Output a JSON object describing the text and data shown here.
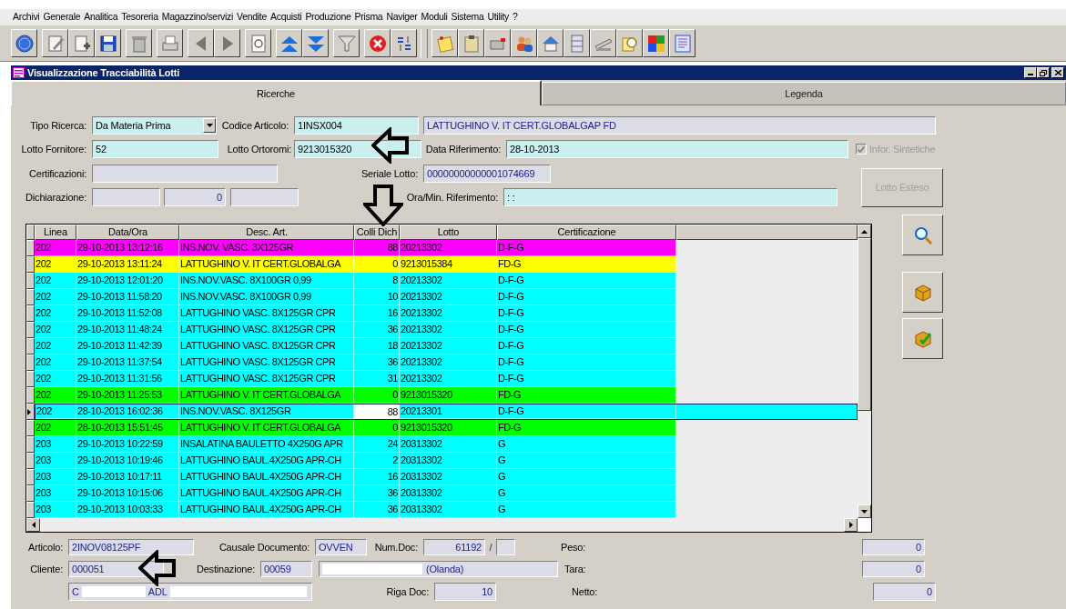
{
  "menu": [
    "Archivi",
    "Generale",
    "Analitica",
    "Tesoreria",
    "Magazzino/servizi",
    "Vendite",
    "Acquisti",
    "Produzione",
    "Prisma",
    "Naviger",
    "Moduli",
    "Sistema",
    "Utility",
    "?"
  ],
  "window": {
    "title": "Visualizzazione Tracciabilità Lotti"
  },
  "tabs": [
    {
      "label": "Ricerche",
      "selected": true
    },
    {
      "label": "Legenda",
      "selected": false
    }
  ],
  "search_form": {
    "tipo_ricerca": {
      "label": "Tipo Ricerca:",
      "value": "Da Materia Prima"
    },
    "codice_articolo": {
      "label": "Codice Articolo:",
      "value": "1INSX004",
      "description": "LATTUGHINO V. IT CERT.GLOBALGAP FD"
    },
    "lotto_fornitore": {
      "label": "Lotto Fornitore:",
      "value": "52"
    },
    "lotto_ortoromi": {
      "label": "Lotto Ortoromi:",
      "value": "9213015320"
    },
    "data_riferimento": {
      "label": "Data Riferimento:",
      "value": "28-10-2013"
    },
    "infor_sintetiche": {
      "label": "Infor. Sintetiche",
      "checked": true,
      "disabled": true
    },
    "certificazioni": {
      "label": "Certificazioni:"
    },
    "seriale_lotto": {
      "label": "Seriale Lotto:",
      "value": "00000000000001074669"
    },
    "dichiarazione": {
      "label": "Dichiarazione:",
      "number": "0"
    },
    "ora_min_riferimento": {
      "label": "Ora/Min. Riferimento:",
      "value": ": :"
    },
    "lotto_esteso_button": {
      "label": "Lotto Esteso",
      "disabled": true
    }
  },
  "table": {
    "columns": [
      "Linea",
      "Data/Ora",
      "Desc. Art.",
      "Colli Dich",
      "Lotto",
      "Certificazione"
    ],
    "rows": [
      {
        "cells": [
          "202",
          "29-10-2013 13:12:16",
          "INS.NOV. VASC. 3X125GR",
          "88",
          "20213302",
          "D-F-G"
        ],
        "color": "#ff00ff",
        "selected": false
      },
      {
        "cells": [
          "202",
          "29-10-2013 13:11:24",
          "LATTUGHINO V. IT CERT.GLOBALGA",
          "0",
          "9213015384",
          "FD-G"
        ],
        "color": "#ffff00",
        "selected": false
      },
      {
        "cells": [
          "202",
          "29-10-2013 12:01:20",
          "INS.NOV.VASC. 8X100GR  0,99",
          "8",
          "20213302",
          "D-F-G"
        ],
        "color": "#00ffff",
        "selected": false
      },
      {
        "cells": [
          "202",
          "29-10-2013 11:58:20",
          "INS.NOV.VASC. 8X100GR  0,99",
          "10",
          "20213302",
          "D-F-G"
        ],
        "color": "#00ffff",
        "selected": false
      },
      {
        "cells": [
          "202",
          "29-10-2013 11:52:08",
          "LATTUGHINO VASC. 8X125GR CPR",
          "16",
          "20213302",
          "D-F-G"
        ],
        "color": "#00ffff",
        "selected": false
      },
      {
        "cells": [
          "202",
          "29-10-2013 11:48:24",
          "LATTUGHINO VASC. 8X125GR CPR",
          "36",
          "20213302",
          "D-F-G"
        ],
        "color": "#00ffff",
        "selected": false
      },
      {
        "cells": [
          "202",
          "29-10-2013 11:42:39",
          "LATTUGHINO VASC. 8X125GR CPR",
          "18",
          "20213302",
          "D-F-G"
        ],
        "color": "#00ffff",
        "selected": false
      },
      {
        "cells": [
          "202",
          "29-10-2013 11:37:54",
          "LATTUGHINO VASC. 8X125GR CPR",
          "36",
          "20213302",
          "D-F-G"
        ],
        "color": "#00ffff",
        "selected": false
      },
      {
        "cells": [
          "202",
          "29-10-2013 11:31:56",
          "LATTUGHINO VASC. 8X125GR CPR",
          "31",
          "20213302",
          "D-F-G"
        ],
        "color": "#00ffff",
        "selected": false
      },
      {
        "cells": [
          "202",
          "29-10-2013 11:25:53",
          "LATTUGHINO V. IT CERT.GLOBALGA",
          "0",
          "9213015320",
          "FD-G"
        ],
        "color": "#00ff00",
        "selected": false
      },
      {
        "cells": [
          "202",
          "28-10-2013 16:02:36",
          "INS.NOV.VASC. 8X125GR",
          "88",
          "20213301",
          "D-F-G"
        ],
        "color": "#00ffff",
        "selected": true
      },
      {
        "cells": [
          "202",
          "28-10-2013 15:51:45",
          "LATTUGHINO V. IT CERT.GLOBALGA",
          "0",
          "9213015320",
          "FD-G"
        ],
        "color": "#00ff00",
        "selected": false
      },
      {
        "cells": [
          "203",
          "29-10-2013 10:22:59",
          "INSALATINA BAULETTO 4X250G APR",
          "24",
          "20313302",
          "G"
        ],
        "color": "#00ffff",
        "selected": false
      },
      {
        "cells": [
          "203",
          "29-10-2013 10:19:46",
          "LATTUGHINO BAUL.4X250G APR-CH",
          "2",
          "20313302",
          "G"
        ],
        "color": "#00ffff",
        "selected": false
      },
      {
        "cells": [
          "203",
          "29-10-2013 10:17:11",
          "LATTUGHINO BAUL.4X250G APR-CH",
          "16",
          "20313302",
          "G"
        ],
        "color": "#00ffff",
        "selected": false
      },
      {
        "cells": [
          "203",
          "29-10-2013 10:15:06",
          "LATTUGHINO BAUL.4X250G APR-CH",
          "36",
          "20313302",
          "G"
        ],
        "color": "#00ffff",
        "selected": false
      },
      {
        "cells": [
          "203",
          "29-10-2013 10:03:33",
          "LATTUGHINO BAUL.4X250G APR-CH",
          "36",
          "20313302",
          "G"
        ],
        "color": "#00ffff",
        "selected": false
      }
    ]
  },
  "details": {
    "articolo": {
      "label": "Articolo:",
      "value": "2INOV08125PF"
    },
    "causale_documento": {
      "label": "Causale Documento:",
      "value": "OVVEN"
    },
    "num_doc": {
      "label": "Num.Doc:",
      "value": "61192",
      "separator": "/"
    },
    "cliente": {
      "label": "Cliente:",
      "value": "000051",
      "name_fragments": [
        "C",
        "ADL"
      ]
    },
    "destinazione": {
      "label": "Destinazione:",
      "value": "00059",
      "name": "(Olanda)"
    },
    "riga_doc": {
      "label": "Riga Doc:",
      "value": "10"
    },
    "peso": {
      "label": "Peso:",
      "value": "0"
    },
    "tara": {
      "label": "Tara:",
      "value": "0"
    },
    "netto": {
      "label": "Netto:",
      "value": "0"
    }
  }
}
